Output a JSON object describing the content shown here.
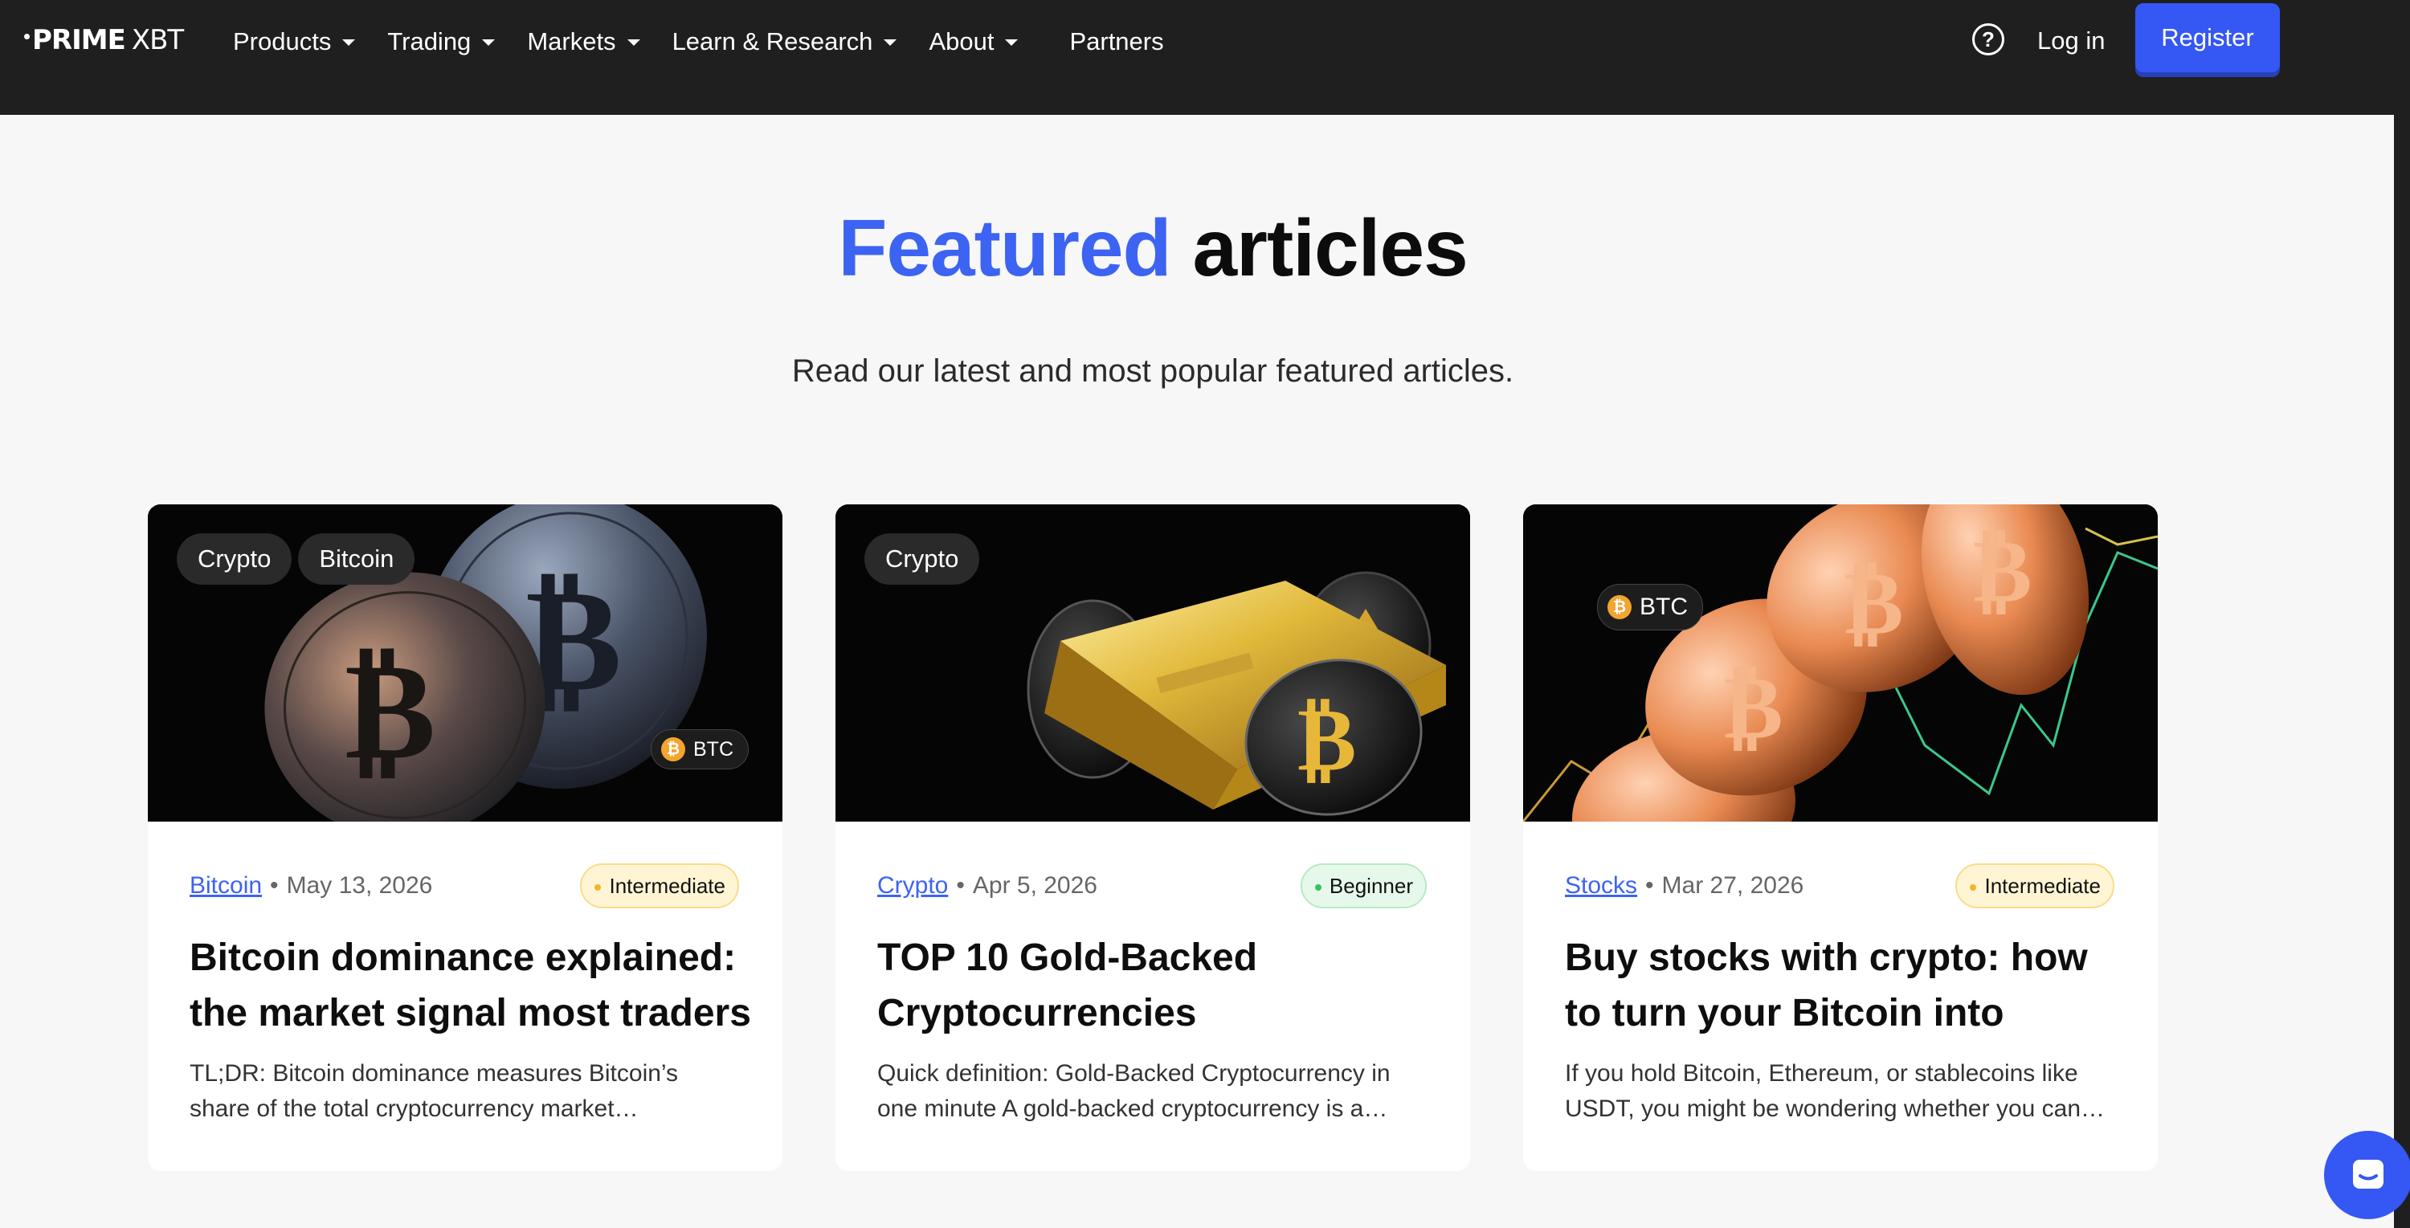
{
  "header": {
    "logo_prime": "PRIME",
    "logo_xbt": "XBT",
    "nav": [
      {
        "label": "Products"
      },
      {
        "label": "Trading"
      },
      {
        "label": "Markets"
      },
      {
        "label": "Learn & Research"
      },
      {
        "label": "About"
      },
      {
        "label": "Partners"
      }
    ],
    "help_glyph": "?",
    "login": "Log in",
    "register": "Register"
  },
  "section": {
    "title_accent": "Featured",
    "title_rest": "articles",
    "subtitle": "Read our latest and most popular featured articles."
  },
  "cards": [
    {
      "tags": [
        "Crypto",
        "Bitcoin"
      ],
      "badge": "BTC",
      "category": "Bitcoin",
      "date": "May 13, 2026",
      "level": "Intermediate",
      "title": "Bitcoin dominance explained: the market signal most traders",
      "excerpt": "TL;DR: Bitcoin dominance measures Bitcoin’s share of the total cryptocurrency market…"
    },
    {
      "tags": [
        "Crypto"
      ],
      "category": "Crypto",
      "date": "Apr 5, 2026",
      "level": "Beginner",
      "title": "TOP 10 Gold-Backed Cryptocurrencies",
      "excerpt": "Quick definition: Gold-Backed Cryptocurrency in one minute A gold-backed cryptocurrency is a…"
    },
    {
      "tags": [],
      "badge": "BTC",
      "category": "Stocks",
      "date": "Mar 27, 2026",
      "level": "Intermediate",
      "title": "Buy stocks with crypto: how to turn your Bitcoin into global",
      "excerpt": "If you hold Bitcoin, Ethereum, or stablecoins like USDT, you might be wondering whether you can…"
    }
  ],
  "colors": {
    "accent": "#3d63f2",
    "register": "#3557f3",
    "topbar": "#1f1f1f",
    "intermediate": "#f0b52b",
    "beginner": "#33c45c"
  },
  "icons": {
    "help": "help-circle-icon",
    "bitcoin": "bitcoin-icon",
    "chat": "chat-icon"
  }
}
